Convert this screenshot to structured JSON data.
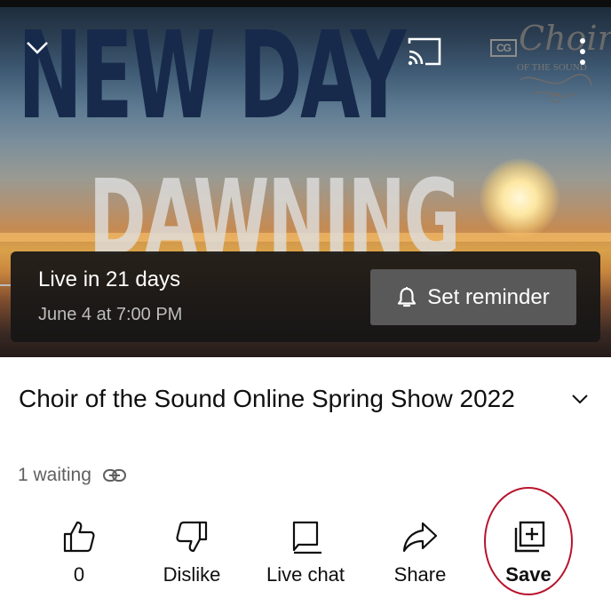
{
  "player": {
    "artwork_line1": "NEW DAY",
    "artwork_line2": "DAWNING",
    "logo_badge": "CG",
    "logo_script": "Choir",
    "logo_subtitle": "OF THE SOUND",
    "live_status": "Live in 21 days",
    "live_date": "June 4 at 7:00 PM",
    "reminder_label": "Set reminder"
  },
  "video": {
    "title": "Choir of the Sound Online Spring Show 2022",
    "waiting": "1 waiting"
  },
  "actions": {
    "like_count": "0",
    "dislike_label": "Dislike",
    "live_chat_label": "Live chat",
    "share_label": "Share",
    "save_label": "Save"
  },
  "colors": {
    "highlight_ring": "#b8142d",
    "panel_bg": "#161616",
    "button_bg": "#595959"
  }
}
